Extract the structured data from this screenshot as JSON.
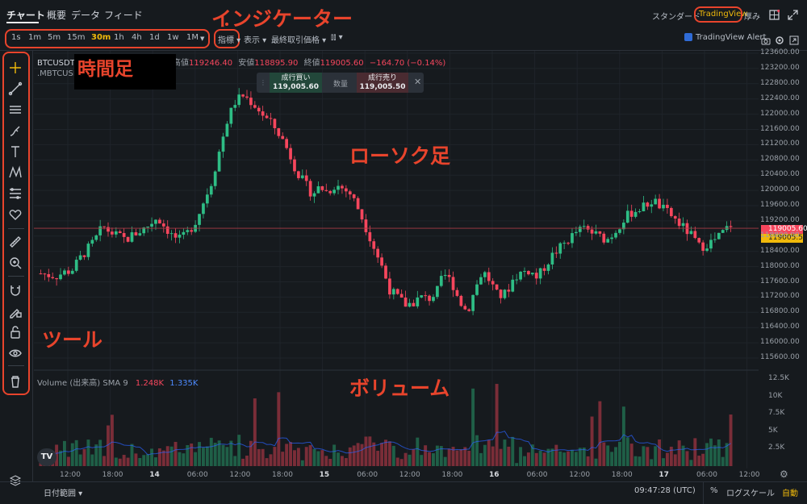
{
  "nav": {
    "tabs": [
      "チャート",
      "概要",
      "データ",
      "フィード"
    ],
    "right": {
      "standard": "スタンダード",
      "tradingview": "TradingView",
      "depth": "厚み"
    }
  },
  "toolbar": {
    "intervals": [
      "1s",
      "1m",
      "5m",
      "15m",
      "30m",
      "1h",
      "4h",
      "1d",
      "1w",
      "1M"
    ],
    "active_interval": "30m",
    "indicators": "指標",
    "display": "表示",
    "last_price": "最終取引価格",
    "alert": "TradingView Alert"
  },
  "annotations": {
    "indicator": "インジケーター",
    "timeframe": "時間足",
    "candles": "ローソク足",
    "tools": "ツール",
    "volume": "ボリューム"
  },
  "ohlc": {
    "symbol": "BTCUSDT",
    "high_label": "高値",
    "high": "119246.40",
    "low_label": "安値",
    "low": "118895.90",
    "close_label": "終値",
    "close": "119005.60",
    "change": "−164.70 (−0.14%)",
    "secondary_symbol": ".MBTCUSDT"
  },
  "trade": {
    "buy_label": "成行買い",
    "buy_price": "119,005.60",
    "qty_label": "数量",
    "sell_label": "成行売り",
    "sell_price": "119,005.50"
  },
  "volume_legend": {
    "label": "Volume (出来高) SMA 9",
    "v1": "1.248K",
    "v2": "1.335K"
  },
  "price_axis": [
    "123600.00",
    "123200.00",
    "122800.00",
    "122400.00",
    "122000.00",
    "121600.00",
    "121200.00",
    "120800.00",
    "120400.00",
    "120000.00",
    "119600.00",
    "119200.00",
    "118800.00",
    "118400.00",
    "118000.00",
    "117600.00",
    "117200.00",
    "116800.00",
    "116400.00",
    "116000.00",
    "115600.00"
  ],
  "price_tags": {
    "last": "119005.60",
    "mark": "119005.50"
  },
  "volume_axis": [
    "12.5K",
    "10K",
    "7.5K",
    "5K",
    "2.5K"
  ],
  "time_axis": [
    {
      "label": "12:00",
      "bold": false
    },
    {
      "label": "18:00",
      "bold": false
    },
    {
      "label": "14",
      "bold": true
    },
    {
      "label": "06:00",
      "bold": false
    },
    {
      "label": "12:00",
      "bold": false
    },
    {
      "label": "18:00",
      "bold": false
    },
    {
      "label": "15",
      "bold": true
    },
    {
      "label": "06:00",
      "bold": false
    },
    {
      "label": "12:00",
      "bold": false
    },
    {
      "label": "18:00",
      "bold": false
    },
    {
      "label": "16",
      "bold": true
    },
    {
      "label": "06:00",
      "bold": false
    },
    {
      "label": "12:00",
      "bold": false
    },
    {
      "label": "18:00",
      "bold": false
    },
    {
      "label": "17",
      "bold": true
    },
    {
      "label": "06:00",
      "bold": false
    },
    {
      "label": "12:00",
      "bold": false
    }
  ],
  "bottom": {
    "date_range": "日付範囲",
    "time": "09:47:28 (UTC)",
    "percent": "%",
    "log": "ログスケール",
    "auto": "自動"
  },
  "colors": {
    "up": "#2ebd85",
    "down": "#f6465d",
    "accent": "#f0b90b",
    "annotation": "#e8442c"
  },
  "chart_data": {
    "type": "candlestick",
    "ylim": [
      115600,
      123600
    ],
    "close_series": [
      117820,
      117780,
      117750,
      117850,
      117900,
      118200,
      118450,
      118700,
      119050,
      118900,
      118800,
      118700,
      118850,
      118950,
      119100,
      119300,
      119050,
      118800,
      118700,
      118900,
      119200,
      119700,
      120200,
      121000,
      121800,
      122300,
      122500,
      122350,
      122150,
      121900,
      121700,
      121400,
      121000,
      120500,
      120200,
      119900,
      120100,
      119950,
      120150,
      120050,
      119900,
      119500,
      119000,
      118500,
      118000,
      117400,
      117200,
      117000,
      117050,
      117200,
      117150,
      117300,
      117800,
      117600,
      117100,
      116800,
      117400,
      117900,
      117600,
      117200,
      117300,
      117700,
      117850,
      117900,
      117700,
      118000,
      118300,
      118500,
      118700,
      118900,
      119000,
      118900,
      118800,
      118700,
      118900,
      119200,
      119400,
      119500,
      119600,
      119750,
      119550,
      119400,
      119200,
      119000,
      118800,
      118500,
      118600,
      118700,
      118900,
      119100
    ],
    "volume_ylim": [
      0,
      12500
    ]
  }
}
